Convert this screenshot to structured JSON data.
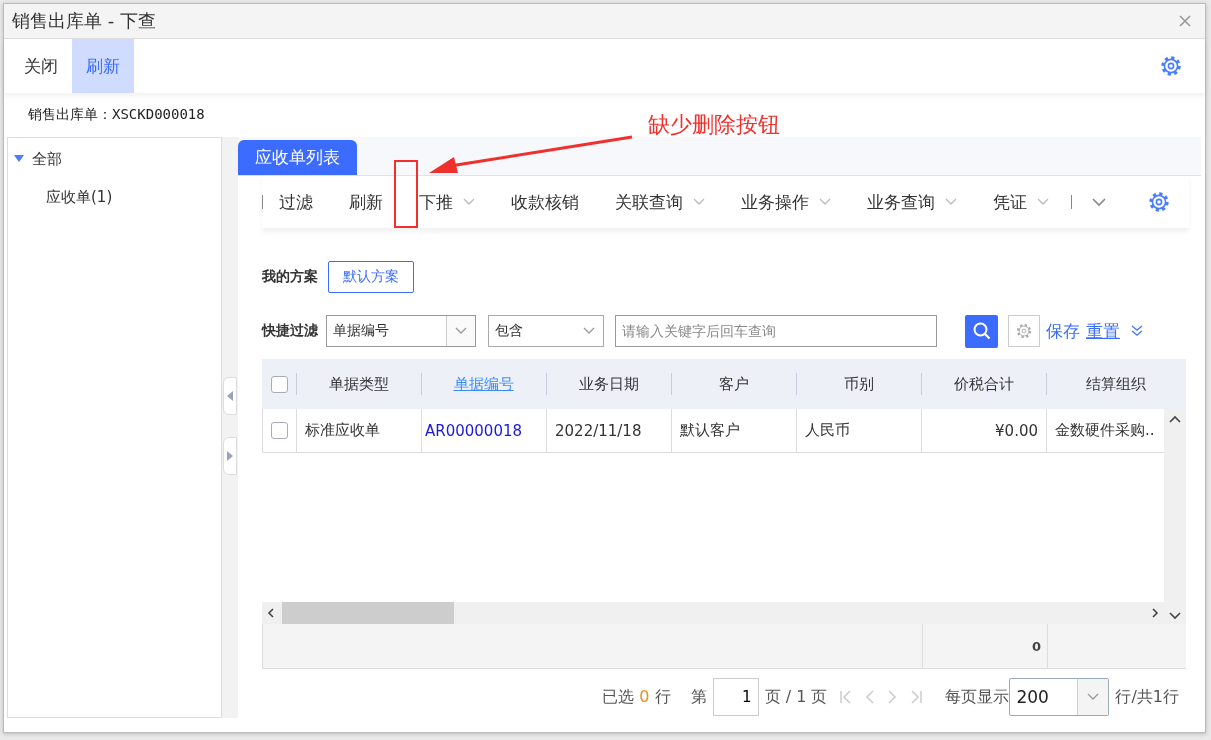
{
  "window": {
    "title": "销售出库单 - 下查"
  },
  "toolbar": [
    {
      "label": "关闭",
      "selected": false
    },
    {
      "label": "刷新",
      "selected": true
    }
  ],
  "source_label": "销售出库单：XSCKD000018",
  "tree": [
    {
      "label": "全部",
      "expanded": true,
      "children": [
        {
          "label": "应收单(1)"
        }
      ]
    }
  ],
  "tabs": [
    {
      "label": "应收单列表",
      "selected": true
    }
  ],
  "actions": [
    {
      "label": "过滤",
      "dropdown": false
    },
    {
      "label": "刷新",
      "dropdown": false
    },
    {
      "label": "下推",
      "dropdown": true
    },
    {
      "label": "收款核销",
      "dropdown": false
    },
    {
      "label": "关联查询",
      "dropdown": true
    },
    {
      "label": "业务操作",
      "dropdown": true
    },
    {
      "label": "业务查询",
      "dropdown": true
    },
    {
      "label": "凭证",
      "dropdown": true
    }
  ],
  "scheme": {
    "label": "我的方案",
    "button": "默认方案"
  },
  "quick_filter": {
    "label": "快捷过滤",
    "field": "单据编号",
    "operator": "包含",
    "placeholder": "请输入关键字后回车查询",
    "save": "保存",
    "reset": "重置"
  },
  "table": {
    "all_checked": false,
    "columns": [
      {
        "label": "单据类型",
        "kind": "text"
      },
      {
        "label": "单据编号",
        "kind": "link"
      },
      {
        "label": "业务日期",
        "kind": "text"
      },
      {
        "label": "客户",
        "kind": "text"
      },
      {
        "label": "币别",
        "kind": "text"
      },
      {
        "label": "价税合计",
        "kind": "amount",
        "total": "0"
      },
      {
        "label": "结算组织",
        "kind": "text"
      }
    ],
    "rows": [
      {
        "checked": false,
        "cells": [
          "标准应收单",
          "AR00000018",
          "2022/11/18",
          "默认客户",
          "人民币",
          "¥0.00",
          "金数硬件采购.."
        ]
      }
    ]
  },
  "pager": {
    "selected_prefix": "已选",
    "selected_count": "0",
    "selected_suffix": "行",
    "page_prefix": "第",
    "page": "1",
    "page_suffix": "页 / 1 页",
    "per_page_label": "每页显示",
    "per_page": "200",
    "total": "行/共1行"
  },
  "annotation": {
    "text": "缺少删除按钮"
  }
}
